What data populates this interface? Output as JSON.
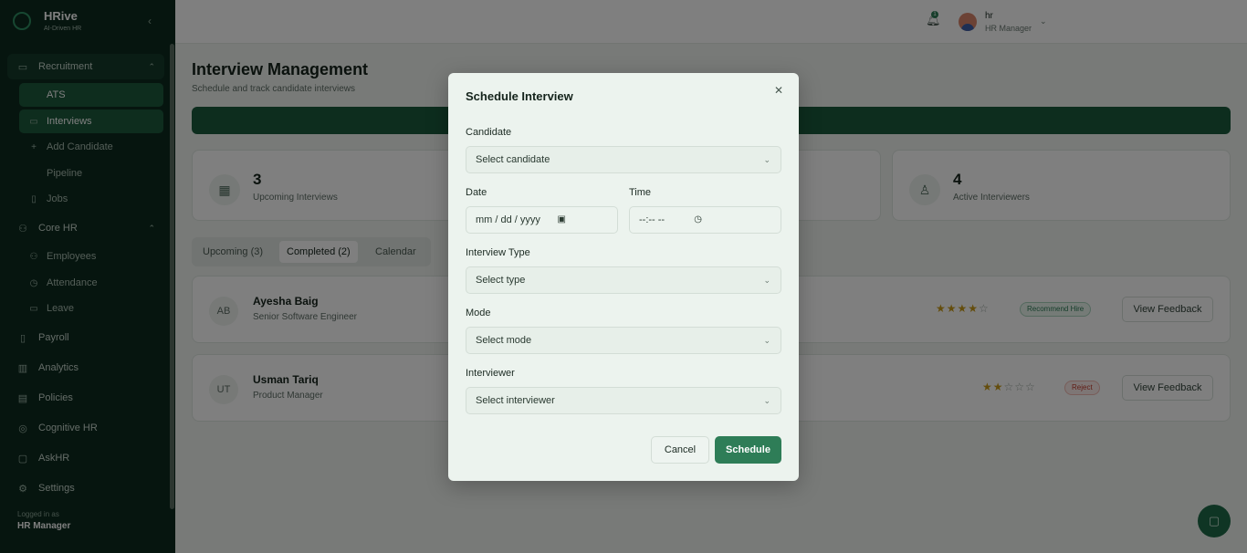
{
  "brand": {
    "name": "HRive",
    "tagline": "AI-Driven HR"
  },
  "sidebar": {
    "groups": [
      {
        "label": "Recruitment",
        "icon": "briefcase-icon"
      },
      {
        "label": "Core HR",
        "icon": "users-icon"
      },
      {
        "label": "Payroll",
        "icon": "file-icon"
      },
      {
        "label": "Analytics",
        "icon": "chart-icon"
      },
      {
        "label": "Policies",
        "icon": "document-icon"
      },
      {
        "label": "Cognitive HR",
        "icon": "brain-icon"
      },
      {
        "label": "AskHR",
        "icon": "chat-icon"
      },
      {
        "label": "Settings",
        "icon": "gear-icon"
      }
    ],
    "recruitment_items": [
      "ATS",
      "Interviews",
      "Add Candidate",
      "Pipeline",
      "Jobs"
    ],
    "corehr_items": [
      "Employees",
      "Attendance",
      "Leave"
    ],
    "logged_in_label": "Logged in as",
    "logged_in_role": "HR Manager"
  },
  "topbar": {
    "user_name": "hr",
    "user_role": "HR Manager",
    "notification_count": "1"
  },
  "page": {
    "title": "Interview Management",
    "subtitle": "Schedule and track candidate interviews"
  },
  "stats": [
    {
      "value": "3",
      "label": "Upcoming Interviews",
      "icon": "calendar-icon"
    },
    {
      "value": "4",
      "label": "Active Interviewers",
      "icon": "user-icon"
    }
  ],
  "tabs": [
    "Upcoming (3)",
    "Completed (2)",
    "Calendar"
  ],
  "interviews": [
    {
      "initials": "AB",
      "name": "Ayesha Baig",
      "role": "Senior Software Engineer",
      "rating": 4,
      "status": "Recommend Hire",
      "action": "View Feedback"
    },
    {
      "initials": "UT",
      "name": "Usman Tariq",
      "role": "Product Manager",
      "rating": 2,
      "status": "Reject",
      "action": "View Feedback"
    }
  ],
  "modal": {
    "title": "Schedule Interview",
    "candidate_label": "Candidate",
    "candidate_value": "Select candidate",
    "date_label": "Date",
    "date_placeholder": "mm / dd / yyyy",
    "time_label": "Time",
    "time_placeholder": "--:-- --",
    "type_label": "Interview Type",
    "type_value": "Select type",
    "mode_label": "Mode",
    "mode_value": "Select mode",
    "interviewer_label": "Interviewer",
    "interviewer_value": "Select interviewer",
    "cancel_label": "Cancel",
    "schedule_label": "Schedule"
  },
  "colors": {
    "brand_green": "#2e7d57",
    "sidebar_bg": "#0d2a1e",
    "star": "#c89a1a",
    "reject": "#c0392b"
  }
}
